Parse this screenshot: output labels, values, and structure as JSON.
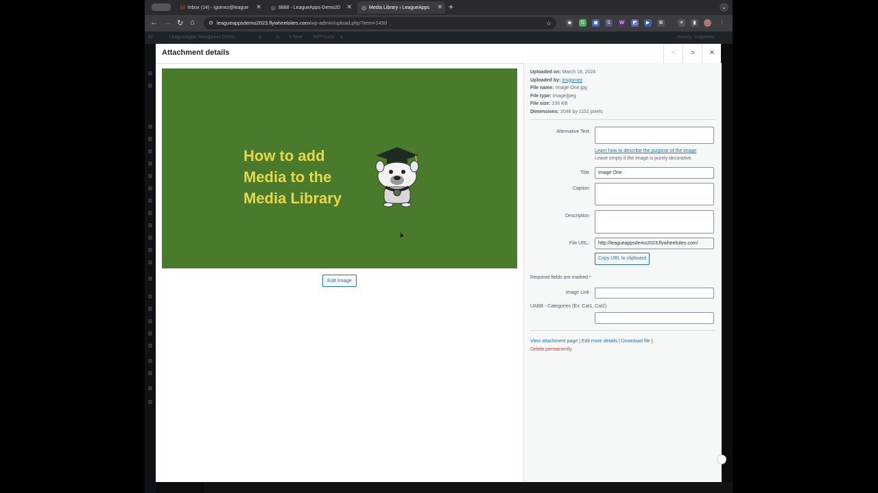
{
  "browser": {
    "tabs": [
      {
        "label": "Inbox (14) - igomez@league",
        "icon": "gmail-icon"
      },
      {
        "label": "8888 - LeagueApps-Demo20",
        "icon": "globe-icon"
      },
      {
        "label": "Media Library ‹ LeagueApps",
        "icon": "wordpress-icon",
        "active": true
      }
    ],
    "new_tab_label": "+",
    "url_host": "leagueappsdemo2023.flywheelsites.com",
    "url_path": "/wp-admin/upload.php?item=1490"
  },
  "wp_admin_bar": {
    "site_name": "LeagueApps Wordpress Demo",
    "updates": "3",
    "comments": "0",
    "new_label": "+ New",
    "wpforms_label": "WPForms",
    "wpforms_count": "4",
    "howdy": "Howdy, irisgomez"
  },
  "modal": {
    "title": "Attachment details",
    "prev_icon": "chevron-left-icon",
    "next_icon": "chevron-right-icon",
    "close_icon": "close-icon",
    "image_text_line1": "How to add",
    "image_text_line2": "Media to the",
    "image_text_line3": "Media Library",
    "edit_image_label": "Edit Image"
  },
  "details": {
    "uploaded_on_label": "Uploaded on:",
    "uploaded_on": "March 18, 2024",
    "uploaded_by_label": "Uploaded by:",
    "uploaded_by": "irisgomez",
    "file_name_label": "File name:",
    "file_name": "Image-One.jpg",
    "file_type_label": "File type:",
    "file_type": "image/jpeg",
    "file_size_label": "File size:",
    "file_size": "106 KB",
    "dimensions_label": "Dimensions:",
    "dimensions": "2048 by 1152 pixels"
  },
  "form": {
    "alt_label": "Alternative Text",
    "alt_value": "",
    "alt_help_link": "Learn how to describe the purpose of the image",
    "alt_help_rest": "Leave empty if the image is purely decorative.",
    "title_label": "Title",
    "title_value": "Image One",
    "caption_label": "Caption",
    "caption_value": "",
    "description_label": "Description",
    "description_value": "",
    "file_url_label": "File URL:",
    "file_url_value": "http://leagueappsdemo2023.flywheelsites.com/",
    "copy_url_label": "Copy URL to clipboard",
    "required_note": "Required fields are marked",
    "required_star": "*",
    "image_link_label": "Image Link",
    "image_link_value": "",
    "uabb_label": "UABB - Categories (Ex: Cat1, Cat2)",
    "uabb_value": ""
  },
  "actions": {
    "view_attachment": "View attachment page",
    "edit_more": "Edit more details",
    "download": "Download file",
    "delete": "Delete permanently",
    "separator": "|"
  },
  "colors": {
    "image_green": "#4a7a2c",
    "image_text": "#e6d84a",
    "link_blue": "#2271b1",
    "delete_red": "#d63638"
  }
}
